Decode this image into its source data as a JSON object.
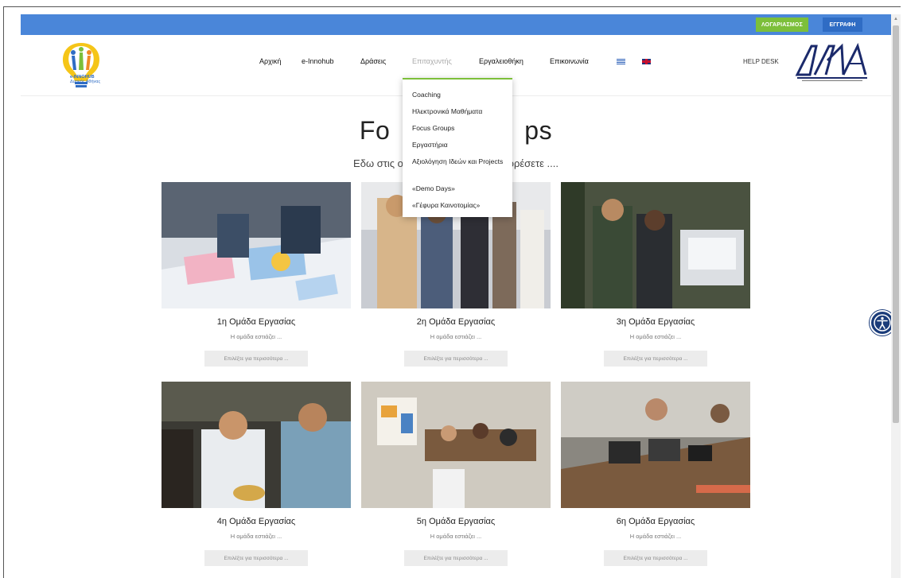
{
  "topbar": {
    "account_label": "ΛΟΓΑΡΙΑΣΜΟΣ",
    "register_label": "ΕΓΓΡΑΦΗ",
    "accent_color": "#4a86d9",
    "account_color": "#7cbf3a",
    "register_color": "#2f6cc4"
  },
  "logo": {
    "line1": "e-INNOHUB",
    "line2": "Δυτικής Αθήνας"
  },
  "nav": {
    "items": [
      {
        "label": "Αρχική"
      },
      {
        "label": "e-Innohub"
      },
      {
        "label": "Δράσεις"
      },
      {
        "label": "Επιταχυντής"
      },
      {
        "label": "Εργαλειοθήκη"
      },
      {
        "label": "Επικοινωνία"
      }
    ],
    "flags": [
      "greek-flag-icon",
      "uk-flag-icon"
    ],
    "helpdesk": "HELP DESK"
  },
  "dropdown": {
    "items": [
      "Coaching",
      "Ηλεκτρονικά Μαθήματα",
      "Focus Groups",
      "Εργαστήρια",
      "Αξιολόγηση Ιδεών και Projects",
      "«Demo Days»",
      "«Γέφυρα Καινοτομίας»"
    ]
  },
  "hero": {
    "title": "Fo                  ps",
    "subtitle": "Εδω στις ομ                                πορέσετε ...."
  },
  "cards": [
    {
      "title": "1η Ομάδα Εργασίας",
      "desc": "Η ομάδα εστιάζει ...",
      "more": "Επιλέξτε για περισσότερα ..."
    },
    {
      "title": "2η Ομάδα Εργασίας",
      "desc": "Η ομάδα εστιάζει ...",
      "more": "Επιλέξτε για περισσότερα ..."
    },
    {
      "title": "3η Ομάδα Εργασίας",
      "desc": "Η ομάδα εστιάζει ...",
      "more": "Επιλέξτε για περισσότερα ..."
    },
    {
      "title": "4η Ομάδα Εργασίας",
      "desc": "Η ομάδα εστιάζει ...",
      "more": "Επιλέξτε για περισσότερα ..."
    },
    {
      "title": "5η Ομάδα Εργασίας",
      "desc": "Η ομάδα εστιάζει ...",
      "more": "Επιλέξτε για περισσότερα ..."
    },
    {
      "title": "6η Ομάδα Εργασίας",
      "desc": "Η ομάδα εστιάζει ...",
      "more": "Επιλέξτε για περισσότερα ..."
    }
  ],
  "accessibility": {
    "icon": "accessibility-icon"
  }
}
